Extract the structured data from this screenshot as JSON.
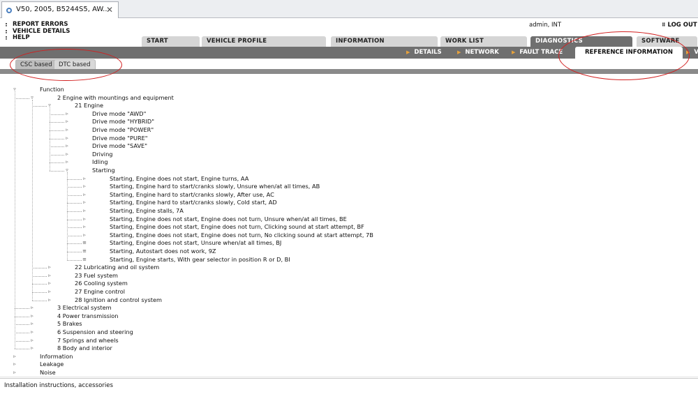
{
  "browser": {
    "tab_title": "V50, 2005, B5244S5, AW...",
    "close_symbol": "✕"
  },
  "topmenu": [
    "REPORT ERRORS",
    "VEHICLE DETAILS",
    "HELP"
  ],
  "user": "admin, INT",
  "logout": "LOG OUT",
  "main_tabs": [
    "START",
    "VEHICLE PROFILE",
    "INFORMATION",
    "WORK LIST",
    "DIAGNOSTICS",
    "SOFTWARE"
  ],
  "active_main_tab": "DIAGNOSTICS",
  "sub_nav": [
    "DETAILS",
    "NETWORK",
    "FAULT TRACE",
    "REFERENCE INFORMATION",
    "V"
  ],
  "active_sub_nav": "REFERENCE INFORMATION",
  "view_tabs": [
    "CSC based",
    "DTC based"
  ],
  "active_view_tab": "CSC based",
  "tree": [
    {
      "label": "Function",
      "level": 0,
      "state": "expanded"
    },
    {
      "label": "2 Engine with mountings and equipment",
      "level": 1,
      "state": "expanded"
    },
    {
      "label": "21 Engine",
      "level": 2,
      "state": "expanded"
    },
    {
      "label": "Drive mode \"AWD\"",
      "level": 3,
      "state": "collapsed"
    },
    {
      "label": "Drive mode \"HYBRID\"",
      "level": 3,
      "state": "collapsed"
    },
    {
      "label": "Drive mode \"POWER\"",
      "level": 3,
      "state": "collapsed"
    },
    {
      "label": "Drive mode \"PURE\"",
      "level": 3,
      "state": "collapsed"
    },
    {
      "label": "Drive mode \"SAVE\"",
      "level": 3,
      "state": "collapsed"
    },
    {
      "label": "Driving",
      "level": 3,
      "state": "collapsed"
    },
    {
      "label": "Idling",
      "level": 3,
      "state": "collapsed"
    },
    {
      "label": "Starting",
      "level": 3,
      "state": "expanded"
    },
    {
      "label": "Starting, Engine does not start, Engine turns, AA",
      "level": 4,
      "state": "collapsed"
    },
    {
      "label": "Starting, Engine hard to start/cranks slowly, Unsure when/at all times, AB",
      "level": 4,
      "state": "collapsed"
    },
    {
      "label": "Starting, Engine hard to start/cranks slowly, After use, AC",
      "level": 4,
      "state": "collapsed"
    },
    {
      "label": "Starting, Engine hard to start/cranks slowly, Cold start, AD",
      "level": 4,
      "state": "collapsed"
    },
    {
      "label": "Starting, Engine stalls, 7A",
      "level": 4,
      "state": "collapsed"
    },
    {
      "label": "Starting, Engine does not start, Engine does not turn, Unsure when/at all times, BE",
      "level": 4,
      "state": "collapsed"
    },
    {
      "label": "Starting, Engine does not start, Engine does not turn, Clicking sound at start attempt, BF",
      "level": 4,
      "state": "collapsed"
    },
    {
      "label": "Starting, Engine does not start, Engine does not turn, No clicking sound at start attempt, 7B",
      "level": 4,
      "state": "collapsed"
    },
    {
      "label": "Starting, Engine does not start, Unsure when/at all times, BJ",
      "level": 4,
      "state": "leaf"
    },
    {
      "label": "Starting, Autostart does not work, 9Z",
      "level": 4,
      "state": "leaf"
    },
    {
      "label": "Starting, Engine starts, With gear selector in position R or D, BI",
      "level": 4,
      "state": "leaf"
    },
    {
      "label": "22 Lubricating and oil system",
      "level": 2,
      "state": "collapsed"
    },
    {
      "label": "23 Fuel system",
      "level": 2,
      "state": "collapsed"
    },
    {
      "label": "26 Cooling system",
      "level": 2,
      "state": "collapsed"
    },
    {
      "label": "27 Engine control",
      "level": 2,
      "state": "collapsed"
    },
    {
      "label": "28 Ignition and control system",
      "level": 2,
      "state": "collapsed"
    },
    {
      "label": "3 Electrical system",
      "level": 1,
      "state": "collapsed"
    },
    {
      "label": "4 Power transmission",
      "level": 1,
      "state": "collapsed"
    },
    {
      "label": "5 Brakes",
      "level": 1,
      "state": "collapsed"
    },
    {
      "label": "6 Suspension and steering",
      "level": 1,
      "state": "collapsed"
    },
    {
      "label": "7 Springs and wheels",
      "level": 1,
      "state": "collapsed"
    },
    {
      "label": "8 Body and interior",
      "level": 1,
      "state": "collapsed"
    },
    {
      "label": "Information",
      "level": 0,
      "state": "collapsed"
    },
    {
      "label": "Leakage",
      "level": 0,
      "state": "collapsed"
    },
    {
      "label": "Noise",
      "level": 0,
      "state": "collapsed"
    }
  ],
  "status_text": "Installation instructions, accessories",
  "colors": {
    "nav_gray": "#6f6f6f",
    "tab_gray": "#d5d5d5",
    "arrow_orange": "#e8a23a",
    "annotation_red": "#d21f1f"
  }
}
